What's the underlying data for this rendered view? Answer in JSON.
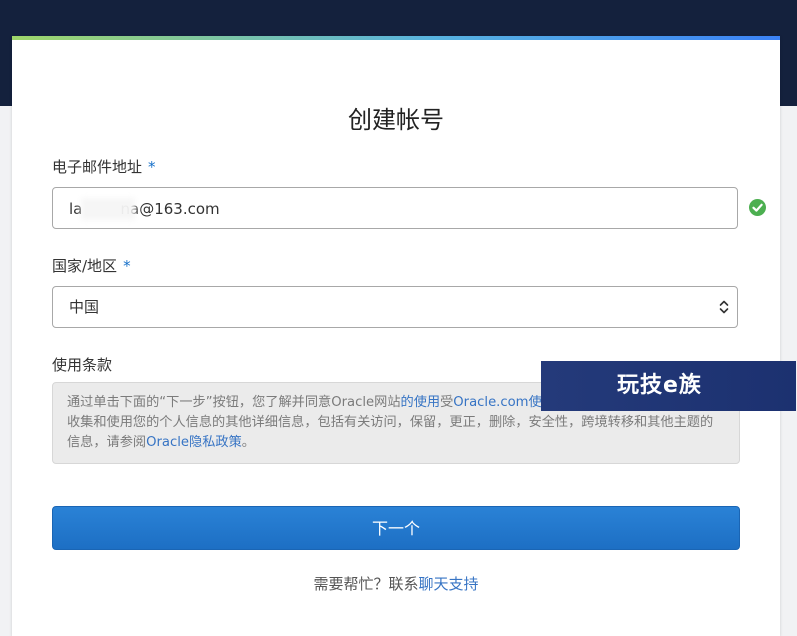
{
  "page": {
    "title": "创建帐号"
  },
  "email": {
    "label": "电子邮件地址",
    "required_mark": "*",
    "value": "la        na@163.com",
    "status_icon": "check-circle-icon",
    "status_color": "#4caf50"
  },
  "country": {
    "label": "国家/地区",
    "required_mark": "*",
    "selected": "中国",
    "icon": "updown-chevron-icon"
  },
  "terms": {
    "label": "使用条款",
    "text_1": "通过单击下面的“下一步”按钮，您了解并同意Oracle网站",
    "link_1": "的使用",
    "text_2": "受",
    "link_2": "Oracle.com使",
    "text_3": "收集和使用您的个人信息的其他详细信息，包括有关访问，保留，更正，删除，安全性，跨境转移和其他主题的信息，请参阅",
    "link_3": "Oracle隐私政策",
    "text_4": "。"
  },
  "actions": {
    "next_label": "下一个"
  },
  "help": {
    "text": "需要帮忙？联系",
    "link": "聊天支持"
  },
  "watermark": {
    "text": "玩技e族"
  },
  "colors": {
    "header_bg": "#14213d",
    "accent_blue": "#1d6fc4",
    "link": "#3774c4"
  }
}
